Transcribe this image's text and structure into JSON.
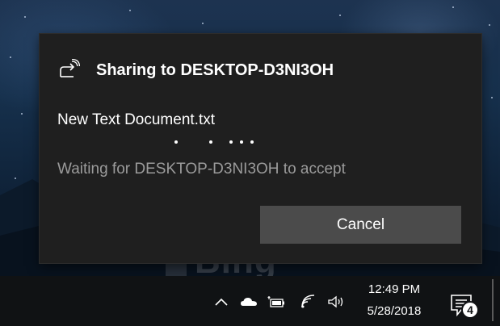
{
  "toast": {
    "title": "Sharing to DESKTOP-D3NI3OH",
    "file_name": "New Text Document.txt",
    "status": "Waiting for DESKTOP-D3NI3OH to accept",
    "cancel_label": "Cancel",
    "icon": "share-icon"
  },
  "taskbar": {
    "time": "12:49 PM",
    "date": "5/28/2018",
    "notification_count": "4",
    "tray_icons": [
      "chevron-up-icon",
      "onedrive-icon",
      "battery-icon",
      "wifi-icon",
      "volume-icon"
    ]
  },
  "desktop": {
    "watermark": "Bing"
  }
}
